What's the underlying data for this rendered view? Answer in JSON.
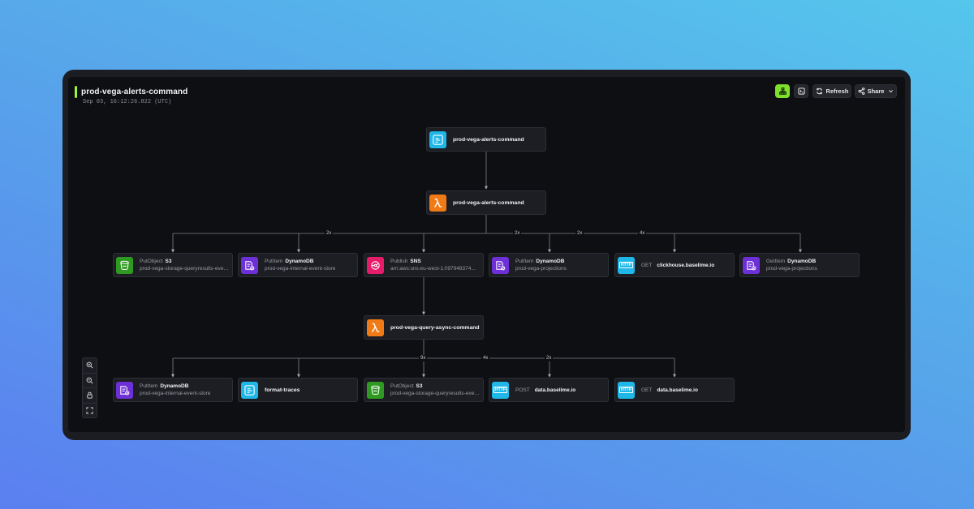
{
  "header": {
    "title": "prod-vega-alerts-command",
    "timestamp": "Sep 03, 16:12:26.822 (UTC)"
  },
  "toolbar": {
    "refresh_label": "Refresh",
    "share_label": "Share"
  },
  "colors": {
    "accent": "#9cf53b",
    "canvas": "#0e0f12",
    "node_bg": "#1c1e23"
  },
  "nodes": {
    "root": {
      "name": "prod-vega-alerts-command",
      "icon": "log-icon"
    },
    "lambda_main": {
      "name": "prod-vega-alerts-command",
      "icon": "lambda-icon"
    },
    "s3_put_1": {
      "op": "PutObject",
      "service": "S3",
      "resource": "prod-vega-storage-queryresults-event-store",
      "icon": "s3-bucket-icon"
    },
    "ddb_put_1": {
      "op": "PutItem",
      "service": "DynamoDB",
      "resource": "prod-vega-internal-event-store",
      "icon": "dynamodb-icon"
    },
    "sns_publish": {
      "op": "Publish",
      "service": "SNS",
      "resource": "arn:aws:sns:eu-west-1:097948374...",
      "icon": "sns-icon"
    },
    "ddb_put_2": {
      "op": "PutItem",
      "service": "DynamoDB",
      "resource": "prod-vega-projections",
      "icon": "dynamodb-icon"
    },
    "http_get_1": {
      "method": "GET",
      "host": "clickhouse.baselime.io",
      "icon": "http-icon"
    },
    "ddb_get": {
      "op": "GetItem",
      "service": "DynamoDB",
      "resource": "prod-vega-projections",
      "icon": "dynamodb-icon"
    },
    "lambda_async": {
      "name": "prod-vega-query-async-command",
      "icon": "lambda-icon"
    },
    "ddb_put_3": {
      "op": "PutItem",
      "service": "DynamoDB",
      "resource": "prod-vega-internal-event-store",
      "icon": "dynamodb-icon"
    },
    "format_traces": {
      "name": "format-traces",
      "icon": "log-icon"
    },
    "s3_put_2": {
      "op": "PutObject",
      "service": "S3",
      "resource": "prod-vega-storage-queryresults-event-store",
      "icon": "s3-bucket-icon"
    },
    "http_post": {
      "method": "POST",
      "host": "data.baselime.io",
      "icon": "http-icon"
    },
    "http_get_2": {
      "method": "GET",
      "host": "data.baselime.io",
      "icon": "http-icon"
    }
  },
  "badges": {
    "b1": "2x",
    "b2": "2x",
    "b3": "2x",
    "b4": "4x",
    "b5": "9x",
    "b6": "4x",
    "b7": "2x"
  },
  "http_tag": "HTTP"
}
